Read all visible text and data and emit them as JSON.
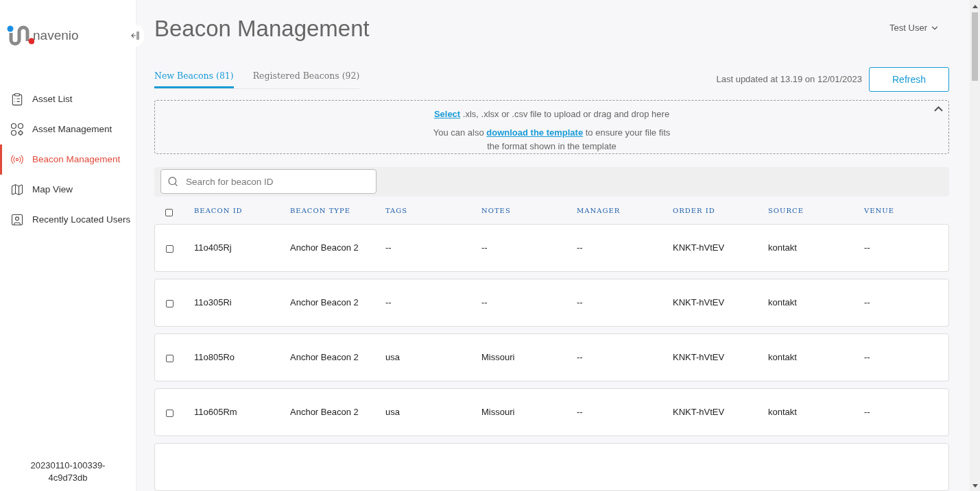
{
  "sidebar": {
    "logo_text": "navenio",
    "items": [
      {
        "label": "Asset List",
        "selected": false
      },
      {
        "label": "Asset Management",
        "selected": false
      },
      {
        "label": "Beacon Management",
        "selected": true
      },
      {
        "label": "Map View",
        "selected": false
      },
      {
        "label": "Recently Located Users",
        "selected": false
      }
    ],
    "build": "20230110-100339-4c9d73db"
  },
  "header": {
    "title": "Beacon Management",
    "user": "Test User"
  },
  "tabs": [
    {
      "label": "New Beacons (81)",
      "selected": true
    },
    {
      "label": "Registered Beacons (92)",
      "selected": false
    }
  ],
  "last_updated": "Last updated at 13.19 on 12/01/2023",
  "refresh_button": "Refresh",
  "upload": {
    "expanded": true,
    "line1_link": "Select",
    "line1_text": " .xls, .xlsx or .csv file to upload or drag and drop here",
    "line2_before": "You can also ",
    "line2_link": "download the template",
    "line2_after": " to ensure your file fits the format shown in the template"
  },
  "search": {
    "placeholder": "Search for beacon ID"
  },
  "table": {
    "columns": [
      "BEACON ID",
      "BEACON TYPE",
      "TAGS",
      "NOTES",
      "MANAGER",
      "ORDER ID",
      "SOURCE",
      "VENUE"
    ],
    "all_checked": false,
    "rows": [
      {
        "checked": false,
        "cells": [
          "11o405Rj",
          "Anchor Beacon 2",
          "--",
          "--",
          "--",
          "KNKT-hVtEV",
          "kontakt",
          "--"
        ]
      },
      {
        "checked": false,
        "cells": [
          "11o305Ri",
          "Anchor Beacon 2",
          "--",
          "--",
          "--",
          "KNKT-hVtEV",
          "kontakt",
          "--"
        ]
      },
      {
        "checked": false,
        "cells": [
          "11o805Ro",
          "Anchor Beacon 2",
          "usa",
          "Missouri",
          "--",
          "KNKT-hVtEV",
          "kontakt",
          "--"
        ]
      },
      {
        "checked": false,
        "cells": [
          "11o605Rm",
          "Anchor Beacon 2",
          "usa",
          "Missouri",
          "--",
          "KNKT-hVtEV",
          "kontakt",
          "--"
        ]
      }
    ]
  }
}
